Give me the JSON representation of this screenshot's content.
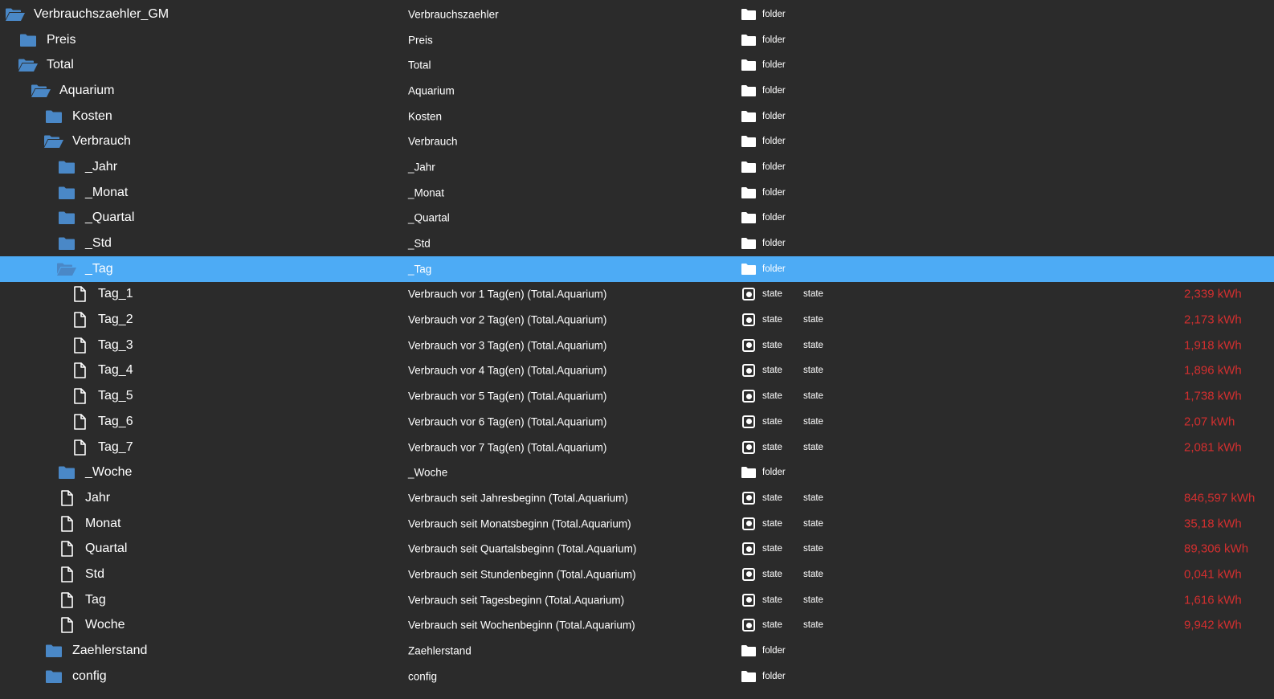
{
  "colors": {
    "background": "#2b2b2b",
    "selected_row": "#4dabf5",
    "tree_folder": "#4a88c7",
    "value_text": "#d32f2f",
    "text": "#ffffff"
  },
  "rows": [
    {
      "name": "Verbrauchszaehler_GM",
      "depth": 0,
      "icon": "folder-open-icon",
      "desc": "Verbrauchszaehler",
      "type": "folder",
      "role": "",
      "value": ""
    },
    {
      "name": "Preis",
      "depth": 1,
      "icon": "folder-icon",
      "desc": "Preis",
      "type": "folder",
      "role": "",
      "value": ""
    },
    {
      "name": "Total",
      "depth": 1,
      "icon": "folder-open-icon",
      "desc": "Total",
      "type": "folder",
      "role": "",
      "value": ""
    },
    {
      "name": "Aquarium",
      "depth": 2,
      "icon": "folder-open-icon",
      "desc": "Aquarium",
      "type": "folder",
      "role": "",
      "value": ""
    },
    {
      "name": "Kosten",
      "depth": 3,
      "icon": "folder-icon",
      "desc": "Kosten",
      "type": "folder",
      "role": "",
      "value": ""
    },
    {
      "name": "Verbrauch",
      "depth": 3,
      "icon": "folder-open-icon",
      "desc": "Verbrauch",
      "type": "folder",
      "role": "",
      "value": ""
    },
    {
      "name": "_Jahr",
      "depth": 4,
      "icon": "folder-icon",
      "desc": "_Jahr",
      "type": "folder",
      "role": "",
      "value": ""
    },
    {
      "name": "_Monat",
      "depth": 4,
      "icon": "folder-icon",
      "desc": "_Monat",
      "type": "folder",
      "role": "",
      "value": ""
    },
    {
      "name": "_Quartal",
      "depth": 4,
      "icon": "folder-icon",
      "desc": "_Quartal",
      "type": "folder",
      "role": "",
      "value": ""
    },
    {
      "name": "_Std",
      "depth": 4,
      "icon": "folder-icon",
      "desc": "_Std",
      "type": "folder",
      "role": "",
      "value": ""
    },
    {
      "name": "_Tag",
      "depth": 4,
      "icon": "folder-open-icon",
      "desc": "_Tag",
      "type": "folder",
      "role": "",
      "value": "",
      "selected": true
    },
    {
      "name": "Tag_1",
      "depth": 5,
      "icon": "file-icon",
      "desc": "Verbrauch vor 1 Tag(en) (Total.Aquarium)",
      "type": "state",
      "role": "state",
      "value": "2,339 kWh"
    },
    {
      "name": "Tag_2",
      "depth": 5,
      "icon": "file-icon",
      "desc": "Verbrauch vor 2 Tag(en) (Total.Aquarium)",
      "type": "state",
      "role": "state",
      "value": "2,173 kWh"
    },
    {
      "name": "Tag_3",
      "depth": 5,
      "icon": "file-icon",
      "desc": "Verbrauch vor 3 Tag(en) (Total.Aquarium)",
      "type": "state",
      "role": "state",
      "value": "1,918 kWh"
    },
    {
      "name": "Tag_4",
      "depth": 5,
      "icon": "file-icon",
      "desc": "Verbrauch vor 4 Tag(en) (Total.Aquarium)",
      "type": "state",
      "role": "state",
      "value": "1,896 kWh"
    },
    {
      "name": "Tag_5",
      "depth": 5,
      "icon": "file-icon",
      "desc": "Verbrauch vor 5 Tag(en) (Total.Aquarium)",
      "type": "state",
      "role": "state",
      "value": "1,738 kWh"
    },
    {
      "name": "Tag_6",
      "depth": 5,
      "icon": "file-icon",
      "desc": "Verbrauch vor 6 Tag(en) (Total.Aquarium)",
      "type": "state",
      "role": "state",
      "value": "2,07 kWh"
    },
    {
      "name": "Tag_7",
      "depth": 5,
      "icon": "file-icon",
      "desc": "Verbrauch vor 7 Tag(en) (Total.Aquarium)",
      "type": "state",
      "role": "state",
      "value": "2,081 kWh"
    },
    {
      "name": "_Woche",
      "depth": 4,
      "icon": "folder-icon",
      "desc": "_Woche",
      "type": "folder",
      "role": "",
      "value": ""
    },
    {
      "name": "Jahr",
      "depth": 4,
      "icon": "file-icon",
      "desc": "Verbrauch seit Jahresbeginn (Total.Aquarium)",
      "type": "state",
      "role": "state",
      "value": "846,597 kWh"
    },
    {
      "name": "Monat",
      "depth": 4,
      "icon": "file-icon",
      "desc": "Verbrauch seit Monatsbeginn (Total.Aquarium)",
      "type": "state",
      "role": "state",
      "value": "35,18 kWh"
    },
    {
      "name": "Quartal",
      "depth": 4,
      "icon": "file-icon",
      "desc": "Verbrauch seit Quartalsbeginn (Total.Aquarium)",
      "type": "state",
      "role": "state",
      "value": "89,306 kWh"
    },
    {
      "name": "Std",
      "depth": 4,
      "icon": "file-icon",
      "desc": "Verbrauch seit Stundenbeginn (Total.Aquarium)",
      "type": "state",
      "role": "state",
      "value": "0,041 kWh"
    },
    {
      "name": "Tag",
      "depth": 4,
      "icon": "file-icon",
      "desc": "Verbrauch seit Tagesbeginn (Total.Aquarium)",
      "type": "state",
      "role": "state",
      "value": "1,616 kWh"
    },
    {
      "name": "Woche",
      "depth": 4,
      "icon": "file-icon",
      "desc": "Verbrauch seit Wochenbeginn (Total.Aquarium)",
      "type": "state",
      "role": "state",
      "value": "9,942 kWh"
    },
    {
      "name": "Zaehlerstand",
      "depth": 3,
      "icon": "folder-icon",
      "desc": "Zaehlerstand",
      "type": "folder",
      "role": "",
      "value": ""
    },
    {
      "name": "config",
      "depth": 3,
      "icon": "folder-icon",
      "desc": "config",
      "type": "folder",
      "role": "",
      "value": ""
    }
  ]
}
